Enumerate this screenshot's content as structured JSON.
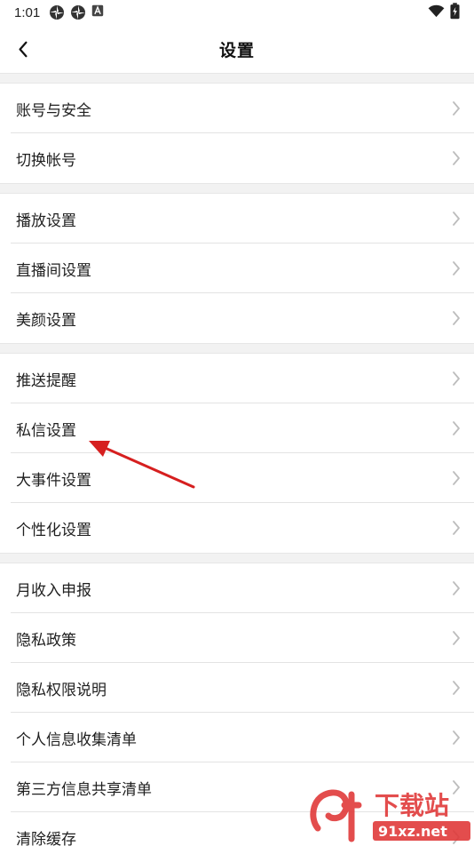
{
  "status_bar": {
    "time": "1:01",
    "left_icons": [
      "pinwheel-icon",
      "pinwheel-icon",
      "a-badge-icon"
    ],
    "right_icons": [
      "wifi-icon",
      "battery-icon"
    ]
  },
  "nav": {
    "title": "设置",
    "back_icon": "chevron-left-icon"
  },
  "groups": [
    {
      "items": [
        {
          "label": "账号与安全"
        },
        {
          "label": "切换帐号"
        }
      ]
    },
    {
      "items": [
        {
          "label": "播放设置"
        },
        {
          "label": "直播间设置"
        },
        {
          "label": "美颜设置"
        }
      ]
    },
    {
      "items": [
        {
          "label": "推送提醒"
        },
        {
          "label": "私信设置"
        },
        {
          "label": "大事件设置"
        },
        {
          "label": "个性化设置"
        }
      ]
    },
    {
      "items": [
        {
          "label": "月收入申报"
        },
        {
          "label": "隐私政策"
        },
        {
          "label": "隐私权限说明"
        },
        {
          "label": "个人信息收集清单"
        },
        {
          "label": "第三方信息共享清单"
        },
        {
          "label": "清除缓存"
        }
      ]
    }
  ],
  "annotation": {
    "color": "#d61f1f",
    "target": "私信设置"
  },
  "watermark": {
    "title": "下载站",
    "site": "91xz.net",
    "logo": "9f-logo",
    "color": "#e03a3a"
  },
  "colors": {
    "background": "#ffffff",
    "separator": "#f2f2f2",
    "chevron": "#bdbdbd"
  }
}
